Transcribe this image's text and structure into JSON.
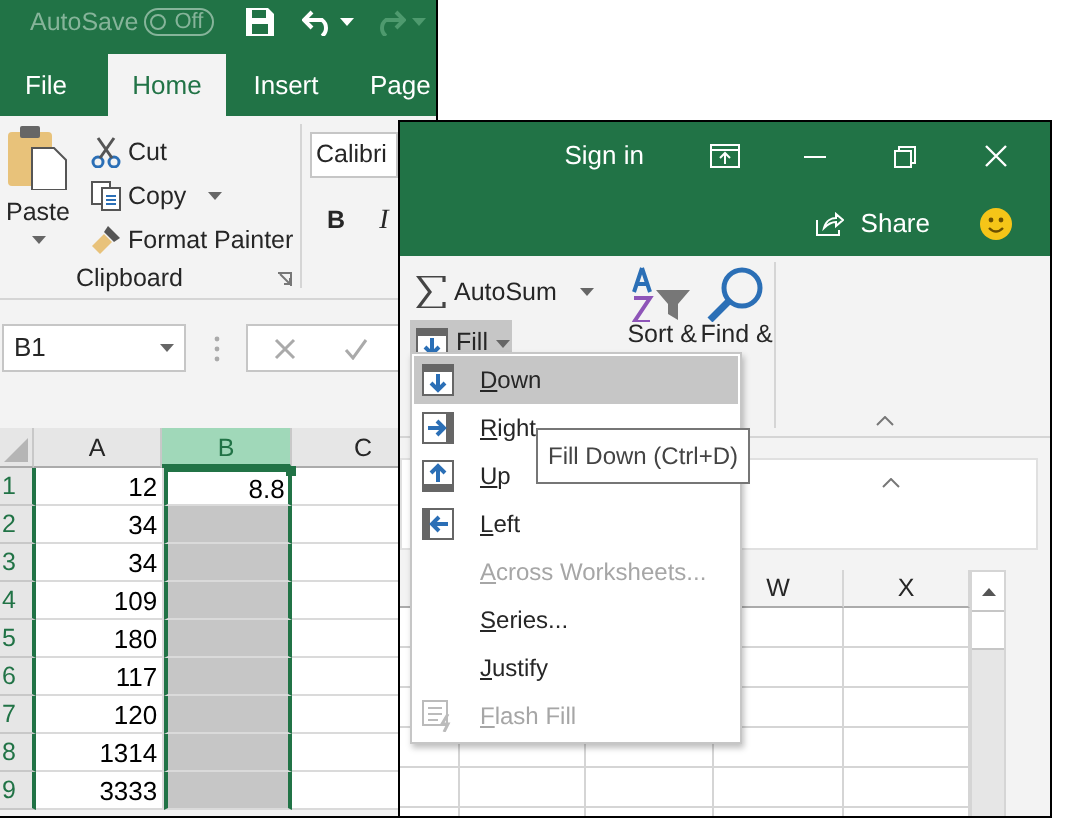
{
  "back_window": {
    "autosave": {
      "label": "AutoSave",
      "toggle": "Off",
      "on": false
    },
    "tabs": [
      {
        "label": "File",
        "selected": false
      },
      {
        "label": "Home",
        "selected": true
      },
      {
        "label": "Insert",
        "selected": false
      },
      {
        "label": "Page",
        "selected": false
      }
    ],
    "clipboard": {
      "paste": "Paste",
      "commands": [
        "Cut",
        "Copy",
        "Format Painter"
      ],
      "group_label": "Clipboard"
    },
    "font": {
      "name": "Calibri",
      "bold": "B",
      "italic": "I"
    },
    "name_box": "B1",
    "columns": [
      {
        "label": "A",
        "selected": false
      },
      {
        "label": "B",
        "selected": true
      },
      {
        "label": "C",
        "selected": false
      }
    ],
    "rows": [
      {
        "number": "1",
        "a": "12",
        "b": "8.8",
        "b_active": true
      },
      {
        "number": "2",
        "a": "34",
        "b_active": false
      },
      {
        "number": "3",
        "a": "34",
        "b_active": false
      },
      {
        "number": "4",
        "a": "109",
        "b_active": false
      },
      {
        "number": "5",
        "a": "180",
        "b_active": false
      },
      {
        "number": "6",
        "a": "117",
        "b_active": false
      },
      {
        "number": "7",
        "a": "120",
        "b_active": false
      },
      {
        "number": "8",
        "a": "1314",
        "b_active": false
      },
      {
        "number": "9",
        "a": "3333",
        "b_active": false
      }
    ]
  },
  "front_window": {
    "sign_in": "Sign in",
    "share": "Share",
    "editing": {
      "autosum": "AutoSum",
      "fill": {
        "label": "Fill",
        "expanded": true
      },
      "sort": "Sort &",
      "find": "Find &"
    },
    "columns": [
      "W",
      "X"
    ]
  },
  "fill_menu": [
    {
      "label": "Down",
      "kind": "down",
      "selected": true,
      "disabled": false
    },
    {
      "label": "Right",
      "kind": "right",
      "selected": false,
      "disabled": false
    },
    {
      "label": "Up",
      "kind": "up",
      "selected": false,
      "disabled": false
    },
    {
      "label": "Left",
      "kind": "left",
      "selected": false,
      "disabled": false
    },
    {
      "label": "Across Worksheets...",
      "kind": "plain",
      "selected": false,
      "disabled": true
    },
    {
      "label": "Series...",
      "kind": "plain",
      "selected": false,
      "disabled": false
    },
    {
      "label": "Justify",
      "kind": "plain",
      "selected": false,
      "disabled": false
    },
    {
      "label": "Flash Fill",
      "kind": "flash",
      "selected": false,
      "disabled": true
    }
  ],
  "tooltip": "Fill Down (Ctrl+D)"
}
